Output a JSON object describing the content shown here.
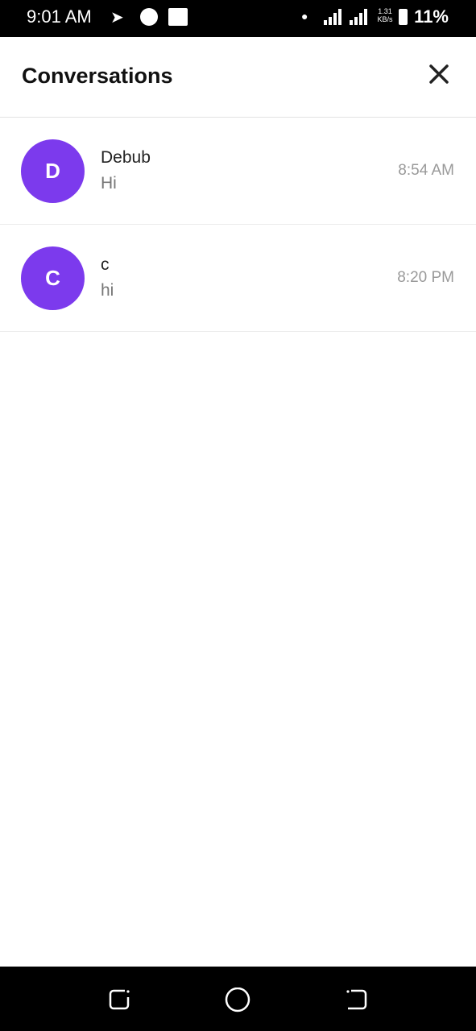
{
  "status_bar": {
    "time": "9:01 AM",
    "net_speed": "1.31 KB/s",
    "battery": "11%"
  },
  "header": {
    "title": "Conversations"
  },
  "conversations": [
    {
      "initial": "D",
      "name": "Debub",
      "last_message": "Hi",
      "time": "8:54 AM"
    },
    {
      "initial": "C",
      "name": "c",
      "last_message": "hi",
      "time": "8:20 PM"
    }
  ],
  "colors": {
    "avatar": "#7c3aed"
  }
}
